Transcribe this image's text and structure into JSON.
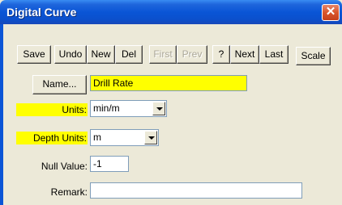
{
  "window": {
    "title": "Digital Curve",
    "close_glyph": "✕"
  },
  "toolbar": {
    "save": "Save",
    "undo": "Undo",
    "new": "New",
    "del": "Del",
    "first": "First",
    "prev": "Prev",
    "help": "?",
    "next": "Next",
    "last": "Last",
    "scale": "Scale"
  },
  "form": {
    "name_button": "Name...",
    "name_value": "Drill Rate",
    "units_label": "Units:",
    "units_value": "min/m",
    "depth_units_label": "Depth Units:",
    "depth_units_value": "m",
    "null_label": "Null Value:",
    "null_value": "-1",
    "remark_label": "Remark:",
    "remark_value": ""
  },
  "colors": {
    "highlight": "#ffff00",
    "title_bar": "#0a55d6",
    "close": "#d9552c"
  }
}
